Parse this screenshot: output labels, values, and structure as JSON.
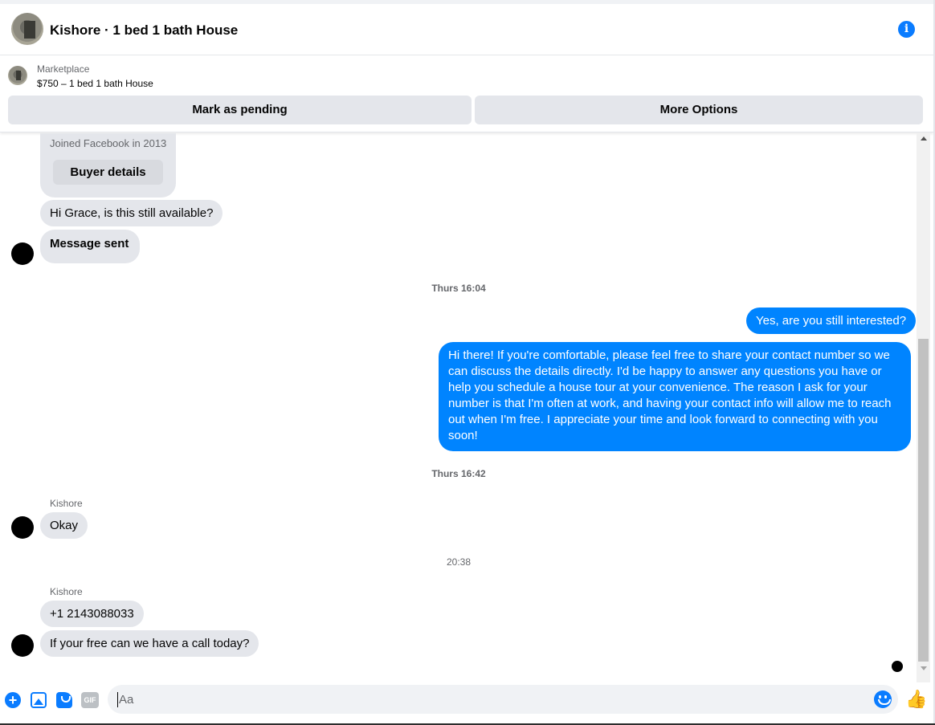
{
  "header": {
    "title": "Kishore · 1 bed 1 bath House"
  },
  "marketplace": {
    "label": "Marketplace",
    "item": "$750 – 1 bed 1 bath House",
    "mark_pending": "Mark as pending",
    "more_options": "More Options"
  },
  "conversation": {
    "joined": "Joined Facebook in 2013",
    "buyer_details": "Buyer details",
    "msg_available": "Hi Grace, is this still available?",
    "msg_sent": "Message sent",
    "ts1": "Thurs 16:04",
    "out1": "Yes, are you still interested?",
    "out2": "Hi there! If you're comfortable, please feel free to share your contact number so we can discuss the details directly. I'd be happy to answer any questions you have or help you schedule a house tour at your convenience. The reason I ask for your number is that I'm often at work, and having your contact info will allow me to reach out when I'm free. I appreciate your time and look forward to connecting with you soon!",
    "ts2": "Thurs 16:42",
    "sender1": "Kishore",
    "in_okay": "Okay",
    "ts3": "20:38",
    "sender2": "Kishore",
    "in_phone": "+1 2143088033",
    "in_call": "If your free can we have a call today?"
  },
  "composer": {
    "placeholder": "Aa",
    "gif_label": "GIF"
  },
  "colors": {
    "accent": "#0a7cff",
    "outgoing_bubble": "#0084ff",
    "incoming_bubble": "#e4e6eb"
  }
}
